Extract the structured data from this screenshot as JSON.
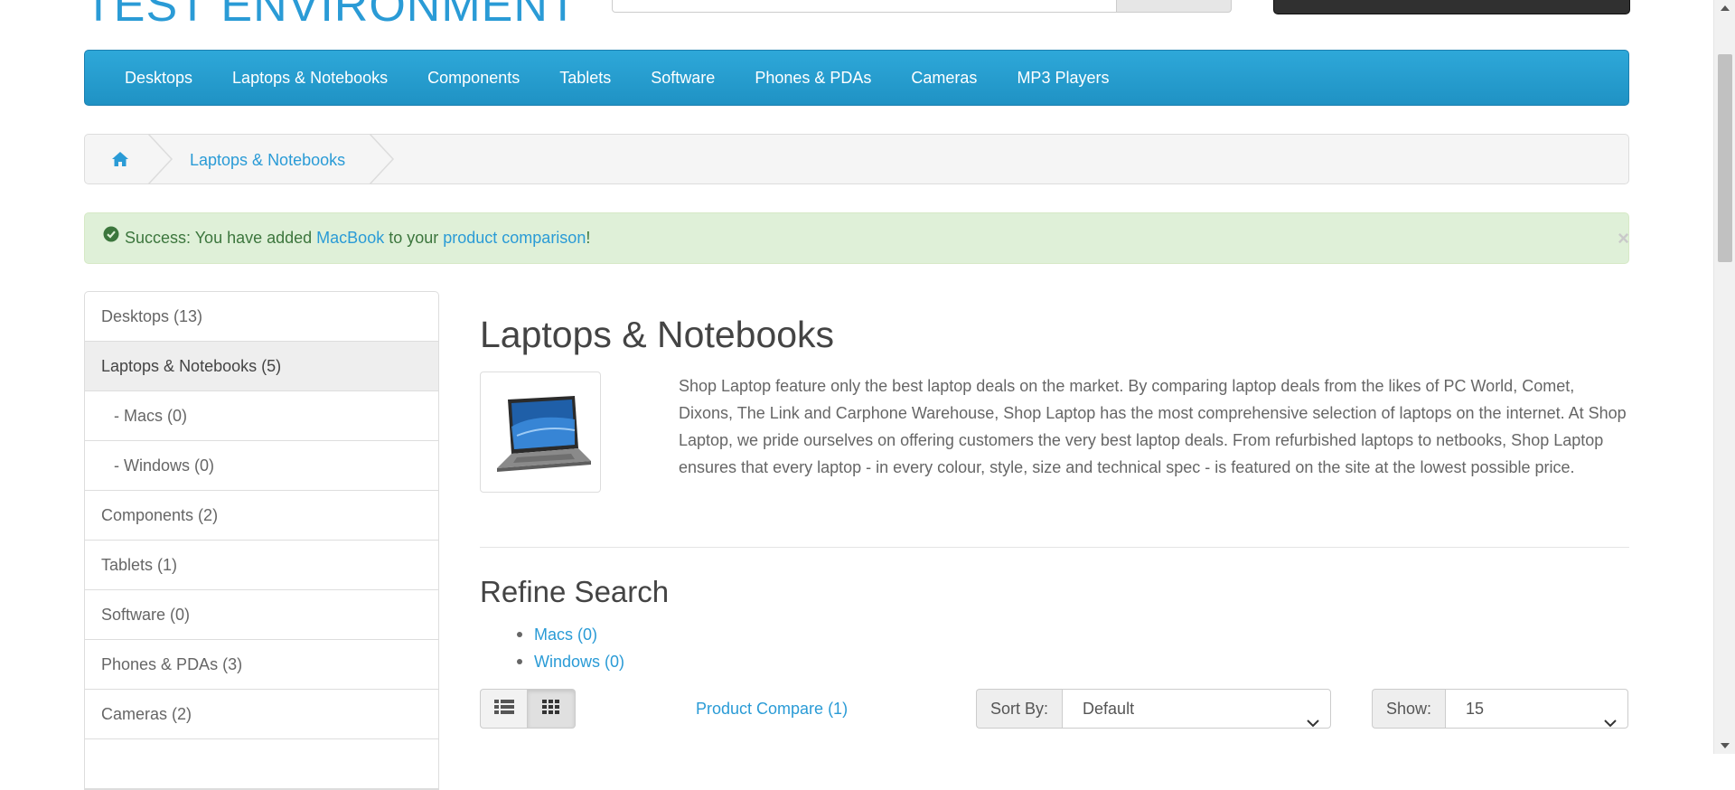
{
  "header": {
    "logo_text": "TEST ENVIRONMENT"
  },
  "nav": {
    "items": [
      {
        "label": "Desktops"
      },
      {
        "label": "Laptops & Notebooks"
      },
      {
        "label": "Components"
      },
      {
        "label": "Tablets"
      },
      {
        "label": "Software"
      },
      {
        "label": "Phones & PDAs"
      },
      {
        "label": "Cameras"
      },
      {
        "label": "MP3 Players"
      }
    ]
  },
  "breadcrumb": {
    "home_icon": "home-icon",
    "current": "Laptops & Notebooks"
  },
  "alert": {
    "icon": "check-circle-icon",
    "prefix": "Success: You have added ",
    "product_link": "MacBook",
    "middle": " to your ",
    "comparison_link": "product comparison",
    "suffix": "!",
    "close": "×"
  },
  "sidebar": {
    "items": [
      {
        "label": "Desktops (13)"
      },
      {
        "label": "Laptops & Notebooks (5)"
      },
      {
        "label": "- Macs (0)"
      },
      {
        "label": "- Windows (0)"
      },
      {
        "label": "Components (2)"
      },
      {
        "label": "Tablets (1)"
      },
      {
        "label": "Software (0)"
      },
      {
        "label": "Phones & PDAs (3)"
      },
      {
        "label": "Cameras (2)"
      }
    ]
  },
  "category": {
    "title": "Laptops & Notebooks",
    "description": "Shop Laptop feature only the best laptop deals on the market. By comparing laptop deals from the likes of PC World, Comet, Dixons, The Link and Carphone Warehouse, Shop Laptop has the most comprehensive selection of laptops on the internet. At Shop Laptop, we pride ourselves on offering customers the very best laptop deals. From refurbished laptops to netbooks, Shop Laptop ensures that every laptop - in every colour, style, size and technical spec - is featured on the site at the lowest possible price."
  },
  "refine": {
    "title": "Refine Search",
    "items": [
      {
        "label": "Macs (0)"
      },
      {
        "label": "Windows (0)"
      }
    ]
  },
  "toolbar": {
    "list_view_icon": "list-view-icon",
    "grid_view_icon": "grid-view-icon",
    "compare_link": "Product Compare (1)",
    "sort_label": "Sort By:",
    "sort_value": "Default",
    "show_label": "Show:",
    "show_value": "15"
  },
  "colors": {
    "brand_blue": "#2a9bd6",
    "nav_bg": "#229cd0",
    "alert_bg": "#dff0d8",
    "alert_text": "#3c763d"
  }
}
